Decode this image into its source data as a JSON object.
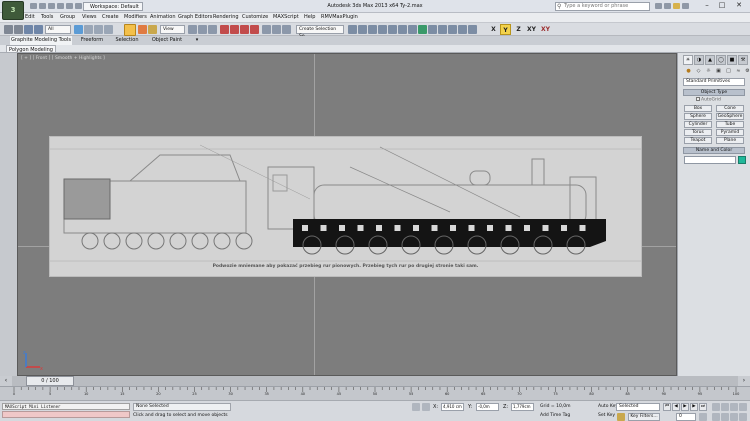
{
  "titlebar": {
    "workspace": "Workspace: Default",
    "title": "Autodesk 3ds Max  2013 x64      Ty-2.max",
    "search_placeholder": "Type a keyword or phrase"
  },
  "menu": [
    "Edit",
    "Tools",
    "Group",
    "Views",
    "Create",
    "Modifiers",
    "Animation",
    "Graph Editors",
    "Rendering",
    "Customize",
    "MAXScript",
    "Help",
    "RMVMaxPlugin"
  ],
  "toolbar": {
    "filter": "All",
    "view": "View",
    "selection_set": "Create Selection Se",
    "axes": [
      "X",
      "Y",
      "Z",
      "XY",
      "XY"
    ]
  },
  "ribbon": {
    "tabs": [
      "Graphite Modeling Tools",
      "Freeform",
      "Selection",
      "Object Paint"
    ],
    "panel": "Polygon Modeling"
  },
  "viewport": {
    "label": "[ + ] [ Front ] [ Smooth + Highlights ]",
    "caption": "Podwozie mniemane aby pokazać przebieg rur pionowych. Przebieg tych rur po drugiej stronie taki sam."
  },
  "command_panel": {
    "tabs": [
      "create",
      "modify",
      "hierarchy",
      "motion",
      "display",
      "utilities"
    ],
    "dropdown": "Standard Primitives",
    "object_type_title": "Object Type",
    "autogrid": "AutoGrid",
    "primitives": [
      "Box",
      "Cone",
      "Sphere",
      "GeoSphere",
      "Cylinder",
      "Tube",
      "Torus",
      "Pyramid",
      "Teapot",
      "Plane"
    ],
    "name_color_title": "Name and Color",
    "swatch_color": "#1fb89a"
  },
  "timeline": {
    "slider": "0 / 100",
    "ticks": [
      "0",
      "5",
      "10",
      "15",
      "20",
      "25",
      "30",
      "35",
      "40",
      "45",
      "50",
      "55",
      "60",
      "65",
      "70",
      "75",
      "80",
      "85",
      "90",
      "95",
      "100"
    ]
  },
  "status": {
    "listener": "MAXScript Mini Listener",
    "selection": "None Selected",
    "prompt": "Click and drag to select and move objects",
    "x": "4,910 cm",
    "y": "-0,0m",
    "z": "1,779cm",
    "grid": "Grid = 10,0m",
    "add_time_tag": "Add Time Tag",
    "auto_key": "Auto Key",
    "set_key": "Set Key",
    "key_mode": "Selected",
    "key_filters": "Key Filters...",
    "frame": "0"
  },
  "blueprint_counts": {
    "tender_wheels": 8,
    "loco_wheels": 9,
    "frame_holes": 16
  }
}
